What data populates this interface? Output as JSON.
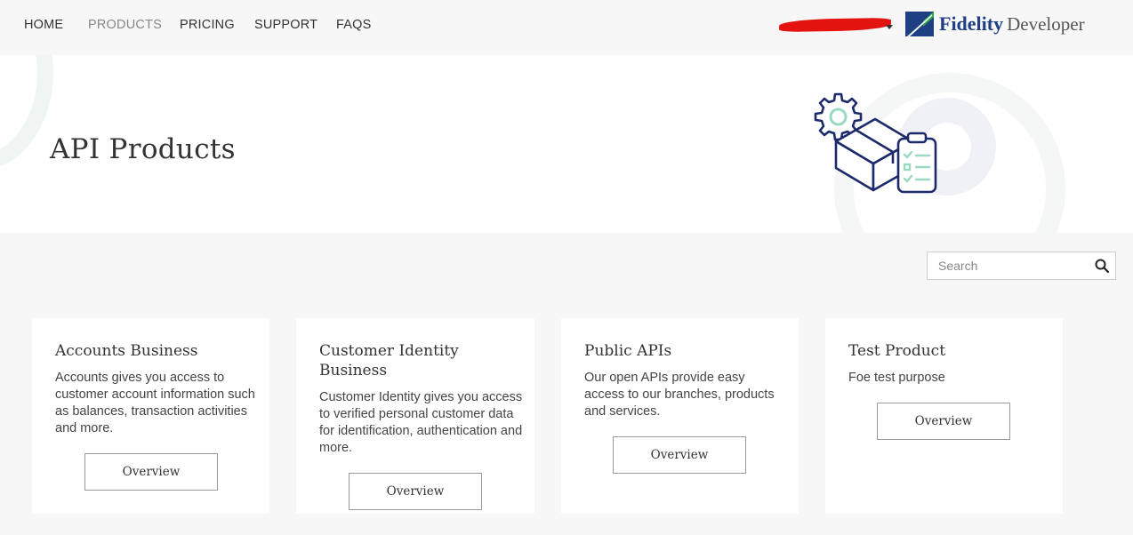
{
  "nav": {
    "items": [
      {
        "label": "HOME"
      },
      {
        "label": "PRODUCTS"
      },
      {
        "label": "PRICING"
      },
      {
        "label": "SUPPORT"
      },
      {
        "label": "FAQS"
      }
    ],
    "active": "PRODUCTS",
    "user": {
      "name": "",
      "redaction_color": "#e3140f"
    },
    "brand": {
      "name": "Fidelity",
      "suffix": "Developer",
      "color": "#1e3f83",
      "accent": "#2faa4a"
    }
  },
  "hero": {
    "title": "API Products",
    "illustration": "gear-box-clipboard-icon"
  },
  "search": {
    "placeholder": "Search",
    "value": "",
    "icon": "search-icon"
  },
  "products": [
    {
      "title": "Accounts Business",
      "description": "Accounts gives you access to customer account information such as balances, transaction activities and more.",
      "button": "Overview"
    },
    {
      "title": "Customer Identity Business",
      "description": "Customer Identity gives you access to verified personal customer data for identification, authentication and more.",
      "button": "Overview"
    },
    {
      "title": "Public APIs",
      "description": "Our open APIs provide easy access to our branches, products and services.",
      "button": "Overview"
    },
    {
      "title": "Test Product",
      "description": "Foe test purpose",
      "button": "Overview"
    }
  ],
  "colors": {
    "page_bg": "#f7f7f7",
    "card_bg": "#ffffff",
    "illustration_navy": "#1c2a6b",
    "illustration_mint": "#9bd9c0"
  }
}
